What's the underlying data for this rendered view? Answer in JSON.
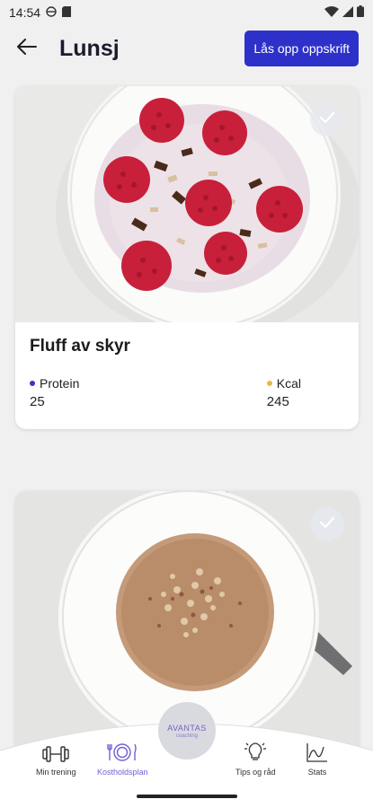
{
  "status_bar": {
    "time": "14:54"
  },
  "app_bar": {
    "title": "Lunsj",
    "unlock_label": "Lås opp oppskrift"
  },
  "recipes": [
    {
      "name": "Fluff av skyr",
      "nutrients": [
        {
          "label": "Protein",
          "value": "25",
          "color": "#3b35c8"
        },
        {
          "label": "Kcal",
          "value": "245",
          "color": "#f2b53a"
        }
      ]
    },
    {
      "name": ""
    }
  ],
  "bottom_nav": {
    "center_brand": "AVANTAS",
    "center_sub": "coaching",
    "items": [
      {
        "label": "Min trening",
        "icon": "dumbbell-icon"
      },
      {
        "label": "Kostholdsplan",
        "icon": "plate-cutlery-icon",
        "active": true
      },
      {
        "label": "Tips og råd",
        "icon": "lightbulb-icon"
      },
      {
        "label": "Stats",
        "icon": "chart-icon"
      }
    ]
  },
  "colors": {
    "accent": "#2e31c9",
    "protein": "#3b35c8",
    "kcal": "#f2b53a",
    "active_nav": "#6f61d6"
  }
}
